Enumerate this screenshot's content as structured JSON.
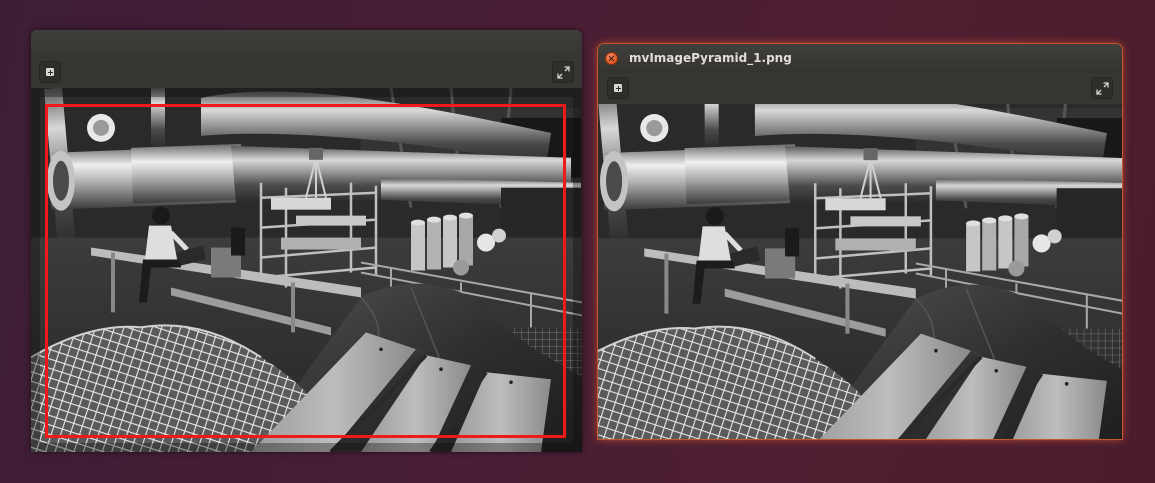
{
  "desktop": {
    "background_colors": [
      "#3d1d36",
      "#4f1f31"
    ]
  },
  "window_left": {
    "title": "",
    "toolbar": {
      "add_icon": "plus-square-icon",
      "fullscreen_icon": "expand-arrows-icon"
    },
    "image": {
      "description_icon": "industrial-scene-grayscale",
      "roi_overlay_color": "#ee1a1a"
    }
  },
  "window_right": {
    "title": "mvImagePyramid_1.png",
    "close_icon": "close-circle-icon",
    "focus_glow_color": "#e2531c",
    "toolbar": {
      "add_icon": "plus-square-icon",
      "fullscreen_icon": "expand-arrows-icon"
    },
    "image": {
      "description_icon": "industrial-scene-grayscale"
    }
  }
}
